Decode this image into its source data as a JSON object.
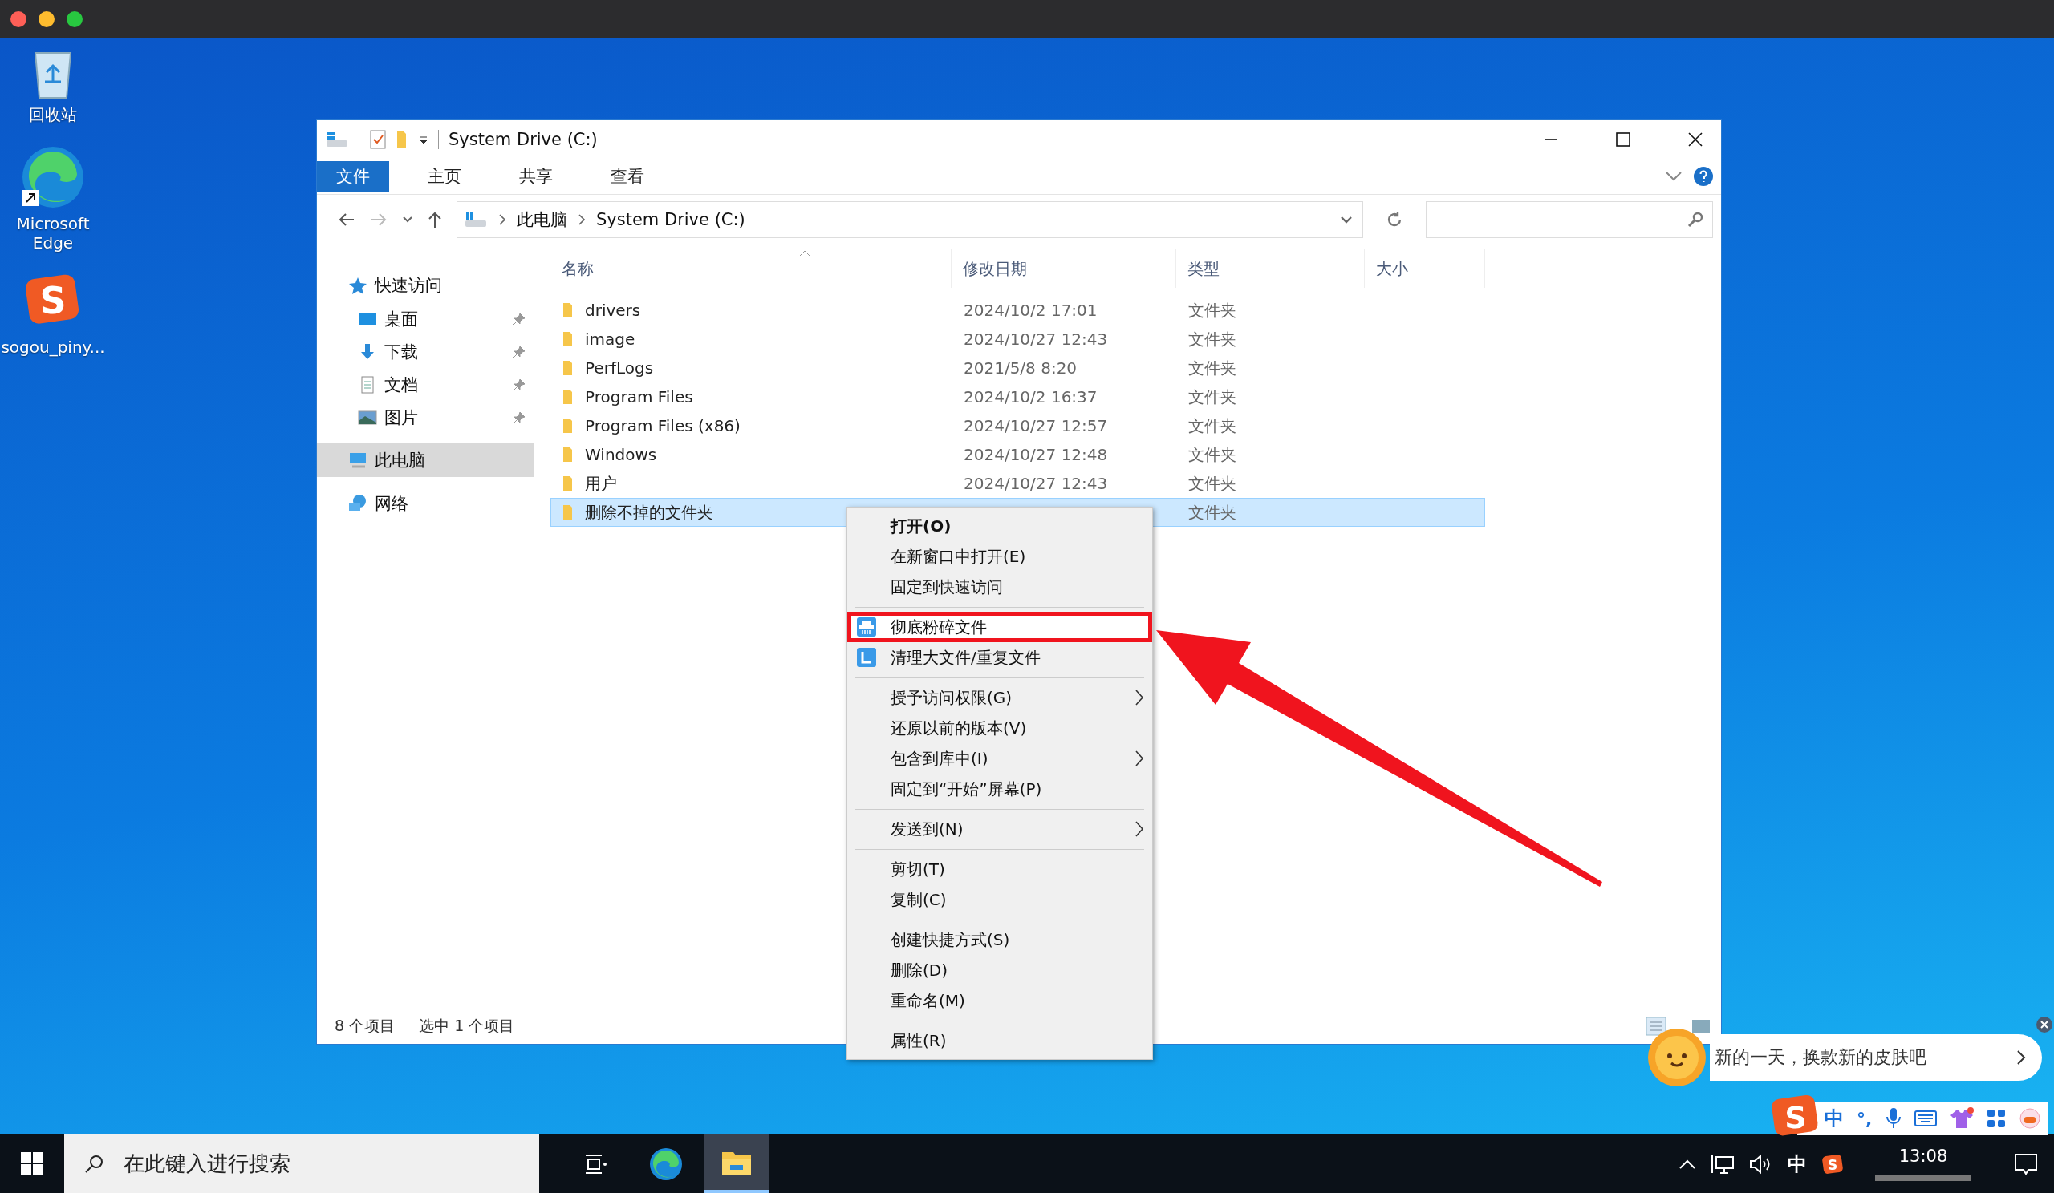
{
  "desktop_icons": [
    {
      "label": "回收站",
      "kind": "recycle"
    },
    {
      "label": "Microsoft Edge",
      "kind": "browser"
    },
    {
      "label": "sogou_piny...",
      "kind": "ime",
      "logo": "S"
    }
  ],
  "explorer": {
    "title": "System Drive (C:)",
    "ribbon_tabs": [
      {
        "label": "文件",
        "selected": true
      },
      {
        "label": "主页",
        "selected": false
      },
      {
        "label": "共享",
        "selected": false
      },
      {
        "label": "查看",
        "selected": false
      }
    ],
    "breadcrumb": [
      "此电脑",
      "System Drive (C:)"
    ],
    "nav": [
      {
        "label": "快速访问",
        "kind": "star",
        "selected": false,
        "children": [
          {
            "label": "桌面",
            "kind": "desktop",
            "selected": false,
            "pinned": true
          },
          {
            "label": "下载",
            "kind": "download",
            "selected": false,
            "pinned": true
          },
          {
            "label": "文档",
            "kind": "document",
            "selected": false,
            "pinned": true
          },
          {
            "label": "图片",
            "kind": "picture",
            "selected": false,
            "pinned": true
          }
        ]
      },
      {
        "label": "此电脑",
        "kind": "computer",
        "selected": true
      },
      {
        "label": "网络",
        "kind": "network",
        "selected": false
      }
    ],
    "columns": [
      "名称",
      "修改日期",
      "类型",
      "大小"
    ],
    "rows": [
      {
        "name": "drivers",
        "modified": "2024/10/2 17:01",
        "type": "文件夹",
        "selected": false
      },
      {
        "name": "image",
        "modified": "2024/10/27 12:43",
        "type": "文件夹",
        "selected": false
      },
      {
        "name": "PerfLogs",
        "modified": "2021/5/8 8:20",
        "type": "文件夹",
        "selected": false
      },
      {
        "name": "Program Files",
        "modified": "2024/10/2 16:37",
        "type": "文件夹",
        "selected": false
      },
      {
        "name": "Program Files (x86)",
        "modified": "2024/10/27 12:57",
        "type": "文件夹",
        "selected": false
      },
      {
        "name": "Windows",
        "modified": "2024/10/27 12:48",
        "type": "文件夹",
        "selected": false
      },
      {
        "name": "用户",
        "modified": "2024/10/27 12:43",
        "type": "文件夹",
        "selected": false
      },
      {
        "name": "删除不掉的文件夹",
        "type": "文件夹",
        "selected": true
      }
    ],
    "status": [
      "8 个项目",
      "选中 1 个项目"
    ]
  },
  "context_menu": [
    {
      "kind": "item",
      "label": "打开(O)",
      "bold": true,
      "submenu": false,
      "highlighted": false
    },
    {
      "kind": "item",
      "label": "在新窗口中打开(E)",
      "bold": false,
      "submenu": false,
      "highlighted": false
    },
    {
      "kind": "item",
      "label": "固定到快速访问",
      "bold": false,
      "submenu": false,
      "highlighted": false
    },
    {
      "kind": "separator"
    },
    {
      "kind": "tool",
      "label": "彻底粉碎文件",
      "bold": false,
      "submenu": false,
      "highlighted": true
    },
    {
      "kind": "tool",
      "label": "清理大文件/重复文件",
      "bold": false,
      "submenu": false,
      "highlighted": false
    },
    {
      "kind": "separator"
    },
    {
      "kind": "item",
      "label": "授予访问权限(G)",
      "bold": false,
      "submenu": true,
      "highlighted": false
    },
    {
      "kind": "item",
      "label": "还原以前的版本(V)",
      "bold": false,
      "submenu": false,
      "highlighted": false
    },
    {
      "kind": "item",
      "label": "包含到库中(I)",
      "bold": false,
      "submenu": true,
      "highlighted": false
    },
    {
      "kind": "item",
      "label": "固定到“开始”屏幕(P)",
      "bold": false,
      "submenu": false,
      "highlighted": false
    },
    {
      "kind": "separator"
    },
    {
      "kind": "item",
      "label": "发送到(N)",
      "bold": false,
      "submenu": true,
      "highlighted": false
    },
    {
      "kind": "separator"
    },
    {
      "kind": "item",
      "label": "剪切(T)",
      "bold": false,
      "submenu": false,
      "highlighted": false
    },
    {
      "kind": "item",
      "label": "复制(C)",
      "bold": false,
      "submenu": false,
      "highlighted": false
    },
    {
      "kind": "separator"
    },
    {
      "kind": "item",
      "label": "创建快捷方式(S)",
      "bold": false,
      "submenu": false,
      "highlighted": false
    },
    {
      "kind": "item",
      "label": "删除(D)",
      "bold": false,
      "submenu": false,
      "highlighted": false
    },
    {
      "kind": "item",
      "label": "重命名(M)",
      "bold": false,
      "submenu": false,
      "highlighted": false
    },
    {
      "kind": "separator"
    },
    {
      "kind": "item",
      "label": "属性(R)",
      "bold": false,
      "submenu": false,
      "highlighted": false
    }
  ],
  "notification": {
    "text": "新的一天，换款新的皮肤吧"
  },
  "ime_bar": {
    "logo": "S",
    "mode": "中",
    "punctuation": "°,"
  },
  "taskbar": {
    "search_placeholder": "在此键入进行搜索",
    "apps": [
      {
        "kind": "task-view",
        "active": false
      },
      {
        "kind": "browser",
        "active": false
      },
      {
        "kind": "folder",
        "active": true
      }
    ],
    "ime": "中",
    "ime_logo": "S",
    "time": "13:08"
  }
}
